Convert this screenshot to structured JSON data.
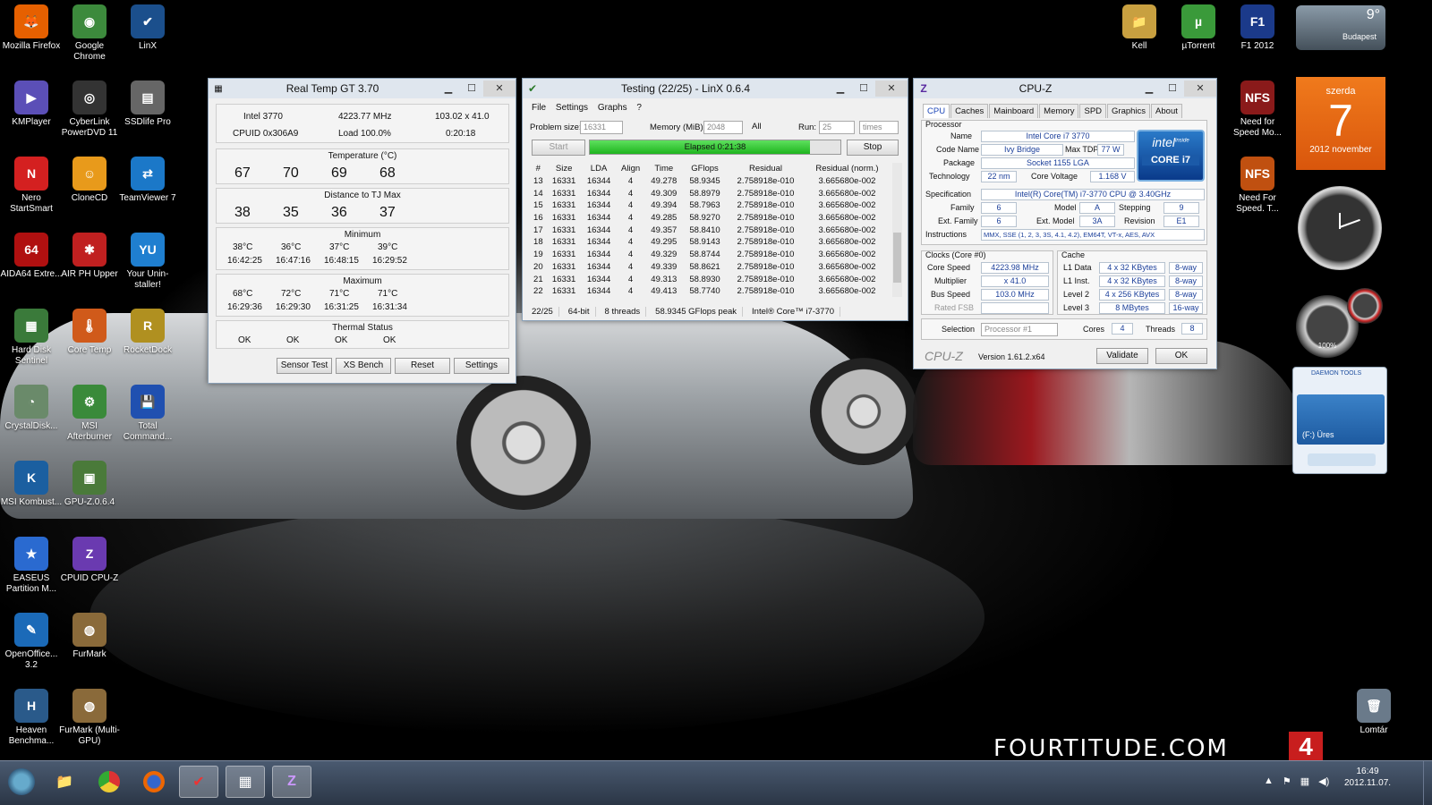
{
  "desktop_icons": [
    {
      "label": "Mozilla Firefox",
      "color": "#e66000",
      "glyph": "🦊"
    },
    {
      "label": "Google Chrome",
      "color": "#3c8a3c",
      "glyph": "◉"
    },
    {
      "label": "LinX",
      "color": "#1b4f8c",
      "glyph": "✔"
    },
    {
      "label": "KMPlayer",
      "color": "#5b4fb7",
      "glyph": "▶"
    },
    {
      "label": "CyberLink PowerDVD 11",
      "color": "#333",
      "glyph": "◎"
    },
    {
      "label": "SSDlife Pro",
      "color": "#666",
      "glyph": "▤"
    },
    {
      "label": "Nero StartSmart",
      "color": "#d42020",
      "glyph": "N"
    },
    {
      "label": "CloneCD",
      "color": "#e89a1b",
      "glyph": "☺"
    },
    {
      "label": "TeamViewer 7",
      "color": "#1b78c8",
      "glyph": "⇄"
    },
    {
      "label": "AIDA64 Extre...",
      "color": "#b01010",
      "glyph": "64"
    },
    {
      "label": "AIR PH Upper",
      "color": "#c02020",
      "glyph": "✱"
    },
    {
      "label": "Your Unin-staller!",
      "color": "#1f7fd0",
      "glyph": "YU"
    },
    {
      "label": "Hard Disk Sentinel",
      "color": "#3a7a3a",
      "glyph": "▦"
    },
    {
      "label": "Core Temp",
      "color": "#d05a1a",
      "glyph": "🌡"
    },
    {
      "label": "RocketDock",
      "color": "#b09020",
      "glyph": "R"
    },
    {
      "label": "CrystalDisk...",
      "color": "#6a8a6a",
      "glyph": "◔"
    },
    {
      "label": "MSI Afterburner",
      "color": "#3a8a3a",
      "glyph": "⚙"
    },
    {
      "label": "Total Command...",
      "color": "#2050b0",
      "glyph": "💾"
    },
    {
      "label": "MSI Kombust...",
      "color": "#1b5fa0",
      "glyph": "K"
    },
    {
      "label": "GPU-Z.0.6.4",
      "color": "#4a7a3a",
      "glyph": "▣"
    },
    {
      "label": "EASEUS Partition M...",
      "color": "#2a6ad0",
      "glyph": "★"
    },
    {
      "label": "CPUID CPU-Z",
      "color": "#6a3ab0",
      "glyph": "Z"
    },
    {
      "label": "OpenOffice... 3.2",
      "color": "#1b6ab8",
      "glyph": "✎"
    },
    {
      "label": "FurMark",
      "color": "#8a6a3a",
      "glyph": "◍"
    },
    {
      "label": "Heaven Benchma...",
      "color": "#2a5a8a",
      "glyph": "H"
    },
    {
      "label": "FurMark (Multi-GPU)",
      "color": "#8a6a3a",
      "glyph": "◍"
    },
    {
      "label": "Kell",
      "color": "#c8a040",
      "glyph": "📁"
    },
    {
      "label": "µTorrent",
      "color": "#3a9a3a",
      "glyph": "µ"
    },
    {
      "label": "F1 2012",
      "color": "#1b3a8a",
      "glyph": "F1"
    },
    {
      "label": "Need for Speed Mo...",
      "color": "#8a1a1a",
      "glyph": "NFS"
    },
    {
      "label": "Need For Speed. T...",
      "color": "#c05010",
      "glyph": "NFS"
    },
    {
      "label": "Lomtár",
      "color": "#6a7a8a",
      "glyph": "🗑"
    }
  ],
  "weather": {
    "temp": "9°",
    "city": "Budapest"
  },
  "calendar": {
    "day_name": "szerda",
    "day": "7",
    "month_year": "2012 november"
  },
  "gauge": {
    "value": "100%"
  },
  "daemon": {
    "title": "DAEMON TOOLS",
    "drive": "(F:) Üres"
  },
  "realtemp": {
    "title": "Real Temp GT 3.70",
    "cpu": "Intel 3770",
    "mhz": "4223.77 MHz",
    "mult": "103.02 x 41.0",
    "cpuid": "CPUID  0x306A9",
    "load": "Load 100.0%",
    "time": "0:20:18",
    "temp_label": "Temperature (°C)",
    "temps": [
      "67",
      "70",
      "69",
      "68"
    ],
    "dist_label": "Distance to TJ Max",
    "dists": [
      "38",
      "35",
      "36",
      "37"
    ],
    "min_label": "Minimum",
    "mins": [
      "38°C",
      "36°C",
      "37°C",
      "39°C"
    ],
    "min_times": [
      "16:42:25",
      "16:47:16",
      "16:48:15",
      "16:29:52"
    ],
    "max_label": "Maximum",
    "maxs": [
      "68°C",
      "72°C",
      "71°C",
      "71°C"
    ],
    "max_times": [
      "16:29:36",
      "16:29:30",
      "16:31:25",
      "16:31:34"
    ],
    "status_label": "Thermal Status",
    "status": [
      "OK",
      "OK",
      "OK",
      "OK"
    ],
    "buttons": [
      "Sensor Test",
      "XS Bench",
      "Reset",
      "Settings"
    ]
  },
  "linx": {
    "title": "Testing (22/25) - LinX 0.6.4",
    "menu": [
      "File",
      "Settings",
      "Graphs",
      "?"
    ],
    "problem_label": "Problem size:",
    "problem": "16331",
    "memory_label": "Memory (MiB):",
    "memory": "2048",
    "all": "All",
    "run_label": "Run:",
    "run": "25",
    "times": "times",
    "start": "Start",
    "elapsed": "Elapsed 0:21:38",
    "stop": "Stop",
    "progress": 0.88,
    "columns": [
      "#",
      "Size",
      "LDA",
      "Align",
      "Time",
      "GFlops",
      "Residual",
      "Residual (norm.)"
    ],
    "rows": [
      [
        "13",
        "16331",
        "16344",
        "4",
        "49.278",
        "58.9345",
        "2.758918e-010",
        "3.665680e-002"
      ],
      [
        "14",
        "16331",
        "16344",
        "4",
        "49.309",
        "58.8979",
        "2.758918e-010",
        "3.665680e-002"
      ],
      [
        "15",
        "16331",
        "16344",
        "4",
        "49.394",
        "58.7963",
        "2.758918e-010",
        "3.665680e-002"
      ],
      [
        "16",
        "16331",
        "16344",
        "4",
        "49.285",
        "58.9270",
        "2.758918e-010",
        "3.665680e-002"
      ],
      [
        "17",
        "16331",
        "16344",
        "4",
        "49.357",
        "58.8410",
        "2.758918e-010",
        "3.665680e-002"
      ],
      [
        "18",
        "16331",
        "16344",
        "4",
        "49.295",
        "58.9143",
        "2.758918e-010",
        "3.665680e-002"
      ],
      [
        "19",
        "16331",
        "16344",
        "4",
        "49.329",
        "58.8744",
        "2.758918e-010",
        "3.665680e-002"
      ],
      [
        "20",
        "16331",
        "16344",
        "4",
        "49.339",
        "58.8621",
        "2.758918e-010",
        "3.665680e-002"
      ],
      [
        "21",
        "16331",
        "16344",
        "4",
        "49.313",
        "58.8930",
        "2.758918e-010",
        "3.665680e-002"
      ],
      [
        "22",
        "16331",
        "16344",
        "4",
        "49.413",
        "58.7740",
        "2.758918e-010",
        "3.665680e-002"
      ]
    ],
    "status": [
      "22/25",
      "64-bit",
      "8 threads",
      "58.9345 GFlops peak",
      "Intel® Core™ i7-3770"
    ]
  },
  "cpuz": {
    "title": "CPU-Z",
    "tabs": [
      "CPU",
      "Caches",
      "Mainboard",
      "Memory",
      "SPD",
      "Graphics",
      "About"
    ],
    "processor_label": "Processor",
    "name_label": "Name",
    "name": "Intel Core i7 3770",
    "codename_label": "Code Name",
    "codename": "Ivy Bridge",
    "tdp_label": "Max TDP",
    "tdp": "77 W",
    "package_label": "Package",
    "package": "Socket 1155 LGA",
    "tech_label": "Technology",
    "tech": "22 nm",
    "voltage_label": "Core Voltage",
    "voltage": "1.168 V",
    "spec_label": "Specification",
    "spec": "Intel(R) Core(TM) i7-3770 CPU @ 3.40GHz",
    "family_label": "Family",
    "family": "6",
    "model_label": "Model",
    "model": "A",
    "stepping_label": "Stepping",
    "stepping": "9",
    "extfamily_label": "Ext. Family",
    "extfamily": "6",
    "extmodel_label": "Ext. Model",
    "extmodel": "3A",
    "revision_label": "Revision",
    "revision": "E1",
    "instr_label": "Instructions",
    "instr": "MMX, SSE (1, 2, 3, 3S, 4.1, 4.2), EM64T, VT-x, AES, AVX",
    "clocks_label": "Clocks (Core #0)",
    "corespeed_label": "Core Speed",
    "corespeed": "4223.98 MHz",
    "multiplier_label": "Multiplier",
    "multiplier": "x 41.0",
    "busspeed_label": "Bus Speed",
    "busspeed": "103.0 MHz",
    "ratedfsb_label": "Rated FSB",
    "cache_label": "Cache",
    "l1d_label": "L1 Data",
    "l1d": "4 x 32 KBytes",
    "l1d_way": "8-way",
    "l1i_label": "L1 Inst.",
    "l1i": "4 x 32 KBytes",
    "l1i_way": "8-way",
    "l2_label": "Level 2",
    "l2": "4 x 256 KBytes",
    "l2_way": "8-way",
    "l3_label": "Level 3",
    "l3": "8 MBytes",
    "l3_way": "16-way",
    "selection_label": "Selection",
    "selection": "Processor #1",
    "cores_label": "Cores",
    "cores": "4",
    "threads_label": "Threads",
    "threads": "8",
    "brand": "CPU-Z",
    "version": "Version 1.61.2.x64",
    "validate": "Validate",
    "ok": "OK",
    "intel_badge": "intel",
    "intel_inside": "inside",
    "core_badge": "CORE i7"
  },
  "watermark": "FOURTITUDE.COM",
  "watermark_num": "4",
  "clock": {
    "time": "16:49",
    "date": "2012.11.07."
  }
}
